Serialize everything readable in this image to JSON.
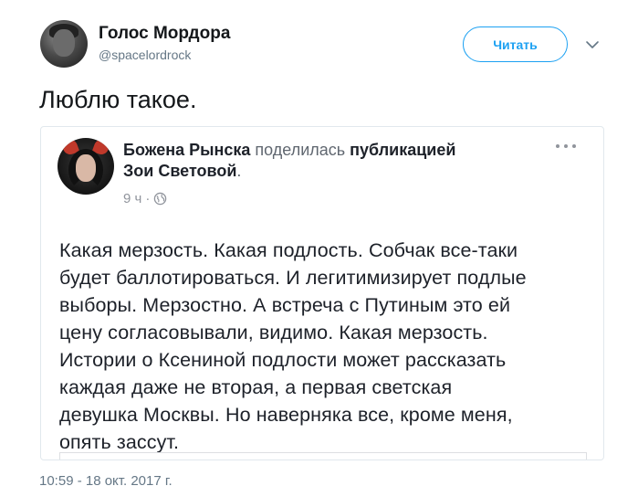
{
  "tweet": {
    "author_name": "Голос Мордора",
    "author_handle": "@spacelordrock",
    "follow_label": "Читать",
    "text": "Люблю такое.",
    "timestamp": "10:59 - 18 окт. 2017 г."
  },
  "embedded_post": {
    "author": "Божена Рынска",
    "shared_verb": "поделилась",
    "shared_object": "публикацией",
    "original_author": "Зои Световой",
    "period": ".",
    "time": "9 ч",
    "separator": "·",
    "body_lines": [
      "Какая мерзость. Какая подлость. Собчак все-таки",
      "будет баллотироваться. И легитимизирует подлые",
      "выборы. Мерзостно. А встреча с Путиным это ей",
      "цену согласовывали, видимо. Какая мерзость.",
      "Истории о Ксениной подлости может рассказать",
      "каждая даже не вторая, а первая светская",
      "девушка Москвы. Но наверняка все, кроме меня,",
      "опять зассут."
    ]
  },
  "icons": {
    "chevron": "chevron-down-icon",
    "globe": "globe-icon",
    "more": "more-options-icon"
  },
  "colors": {
    "accent": "#1da1f2",
    "text": "#14171a",
    "muted": "#657786",
    "card_border": "#e1e8ed"
  }
}
